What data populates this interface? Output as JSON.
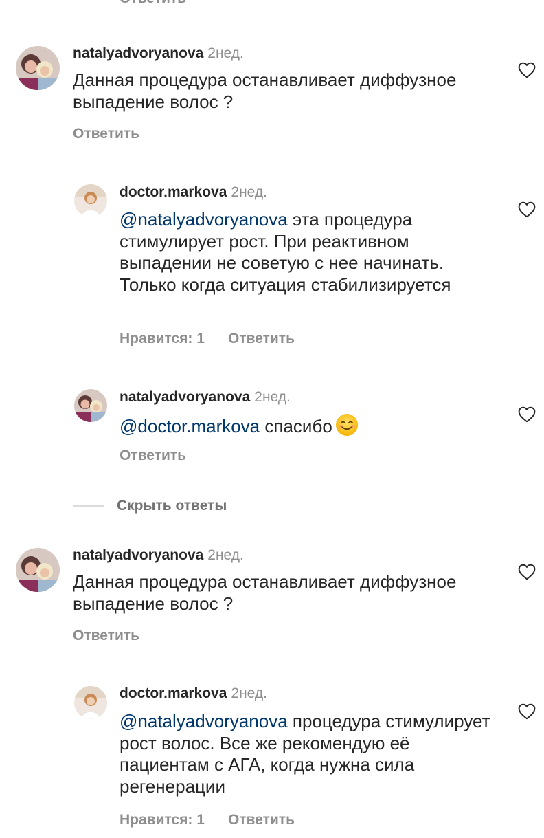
{
  "top_partial": {
    "reply_label": "Ответить"
  },
  "comments": [
    {
      "username": "natalyadvoryanova",
      "time": "2нед.",
      "text": "Данная процедура останавливает диффузное выпадение волос ?",
      "reply_label": "Ответить"
    },
    {
      "username": "doctor.markova",
      "time": "2нед.",
      "mention": "@natalyadvoryanova",
      "text": "эта процедура стимулирует рост. При реактивном выпадении не советую с нее начинать. Только когда ситуация стабилизируется",
      "likes_label": "Нравится: 1",
      "reply_label": "Ответить"
    },
    {
      "username": "natalyadvoryanova",
      "time": "2нед.",
      "mention": "@doctor.markova",
      "text": "спасибо",
      "emoji": "smiling-face-emoji",
      "reply_label": "Ответить"
    },
    {
      "username": "natalyadvoryanova",
      "time": "2нед.",
      "text": "Данная процедура останавливает диффузное выпадение волос ?",
      "reply_label": "Ответить"
    },
    {
      "username": "doctor.markova",
      "time": "2нед.",
      "mention": "@natalyadvoryanova",
      "text": "процедура стимулирует рост волос. Все же рекомендую её пациентам с АГА, когда нужна сила регенерации",
      "likes_label": "Нравится: 1",
      "reply_label": "Ответить"
    }
  ],
  "hide_replies_label": "Скрыть ответы",
  "icons": {
    "like": "heart-outline-icon",
    "avatar_nataly": "avatar-photo",
    "avatar_doctor": "avatar-photo"
  },
  "colors": {
    "text": "#262626",
    "secondary": "#8e8e8e",
    "mention": "#00376b",
    "divider": "#dbdbdb"
  }
}
